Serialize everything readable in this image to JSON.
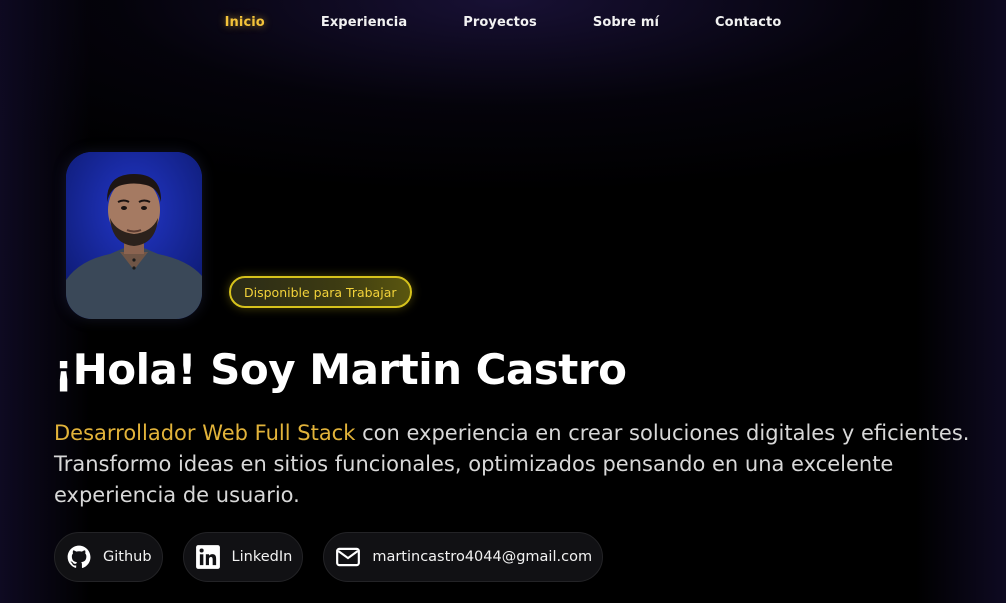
{
  "nav": {
    "items": [
      {
        "label": "Inicio",
        "active": true
      },
      {
        "label": "Experiencia",
        "active": false
      },
      {
        "label": "Proyectos",
        "active": false
      },
      {
        "label": "Sobre mí",
        "active": false
      },
      {
        "label": "Contacto",
        "active": false
      }
    ]
  },
  "hero": {
    "badge": "Disponible para Trabajar",
    "title": "¡Hola! Soy Martin Castro",
    "description_highlight": "Desarrollador Web Full Stack",
    "description_rest": " con experiencia en crear soluciones digitales y eficientes. Transformo ideas en sitios funcionales, optimizados pensando en una excelente experiencia de usuario."
  },
  "contacts": [
    {
      "label": "Github",
      "icon": "github-icon"
    },
    {
      "label": "LinkedIn",
      "icon": "linkedin-icon"
    },
    {
      "label": "martincastro4044@gmail.com",
      "icon": "mail-icon"
    }
  ],
  "colors": {
    "accent": "#f4c33a",
    "highlight_text": "#e2b33a",
    "badge_border": "#d6c21c",
    "background": "#000000"
  }
}
